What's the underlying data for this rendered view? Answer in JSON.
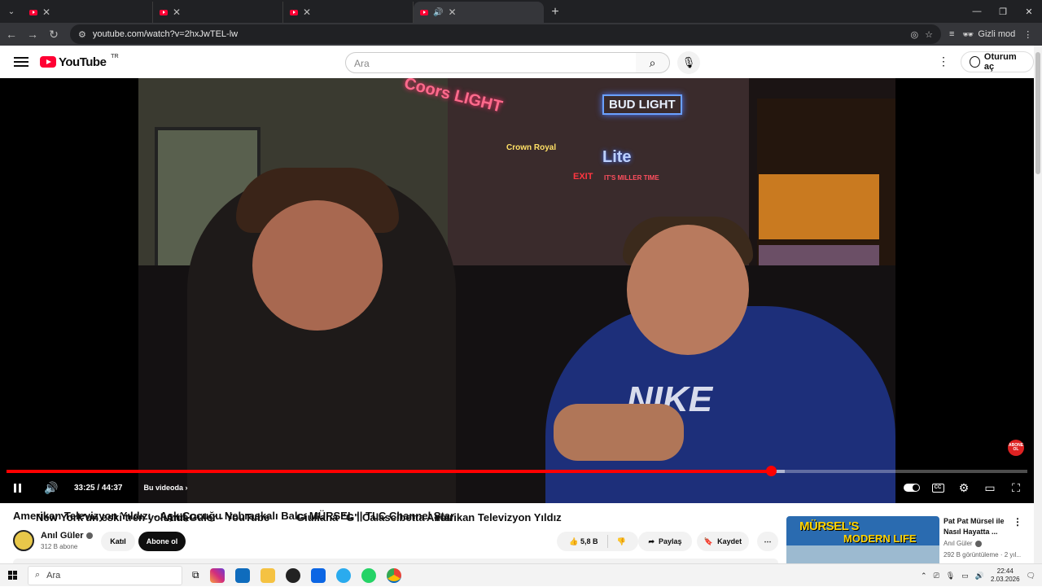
{
  "browser": {
    "tabs": [
      {
        "title": "New York'un eski tren yolunda",
        "active": false
      },
      {
        "title": "Anıl Güler - YouTube",
        "active": false
      },
      {
        "title": "Giuliana \"G\" Calascibetta - You",
        "active": false
      },
      {
        "title": "Amerikan Televizyon Yıldız",
        "active": true
      }
    ],
    "url": "youtube.com/watch?v=2hxJwTEL-lw",
    "incognito_label": "Gizli mod"
  },
  "header": {
    "logo_text": "YouTube",
    "country_code": "TR",
    "search_placeholder": "Ara",
    "signin_label": "Oturum aç"
  },
  "player": {
    "time_display": "33:25 / 44:37",
    "progress_fraction": 0.749,
    "buffer_fraction": 0.762,
    "chapter_label": "Bu videoda",
    "badge_text": "ABONE OL"
  },
  "video_scene": {
    "sign_coors": "Coors LIGHT",
    "sign_bud": "BUD LIGHT",
    "sign_lite": "Lite",
    "sign_miller": "IT'S MILLER TIME",
    "sign_crown": "Crown Royal",
    "sign_exit": "EXIT",
    "shirt_logo": "NIKE"
  },
  "video": {
    "title": "Amerikan Televizyon Yıldızı - Aşk Çocuğu Nebraskalı Balcı MÜRSEL || TLC Channel Star",
    "channel": "Anıl Güler",
    "subscribers": "312 B abone",
    "join_label": "Katıl",
    "subscribe_label": "Abone ol",
    "likes": "5,8 B",
    "share_label": "Paylaş",
    "save_label": "Kaydet"
  },
  "recommendation": {
    "thumb_text_1": "MÜRSEL'S",
    "thumb_text_2": "MODERN LIFE",
    "title": "Pat Pat Mürsel ile Nasıl Hayatta ...",
    "channel": "Anıl Güler",
    "meta": "292 B görüntüleme · 2 yıl..."
  },
  "taskbar": {
    "search_placeholder": "Ara",
    "time": "22:44",
    "date": "2.03.2026"
  },
  "colors": {
    "yt_red": "#ff0000",
    "chrome_dark": "#202124",
    "chrome_tab_active": "#35363a"
  }
}
